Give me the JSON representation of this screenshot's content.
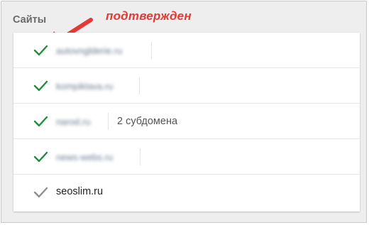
{
  "section_title": "Сайты",
  "annotation": {
    "text": "подтвержден",
    "color": "#e53935"
  },
  "icons": {
    "verified": "check-icon",
    "unverified": "check-icon"
  },
  "colors": {
    "verified_check": "#1e8e3e",
    "unverified_check": "#8e8e8e"
  },
  "sites": [
    {
      "domain": "autovnglderie.ru",
      "verified": true,
      "blurred": true,
      "subdomains": ""
    },
    {
      "domain": "kompiklava.ru",
      "verified": true,
      "blurred": true,
      "subdomains": ""
    },
    {
      "domain": "narod.ru",
      "verified": true,
      "blurred": true,
      "subdomains": "2 субдомена"
    },
    {
      "domain": "news-webs.ru",
      "verified": true,
      "blurred": true,
      "subdomains": ""
    },
    {
      "domain": "seoslim.ru",
      "verified": false,
      "blurred": false,
      "subdomains": ""
    }
  ]
}
